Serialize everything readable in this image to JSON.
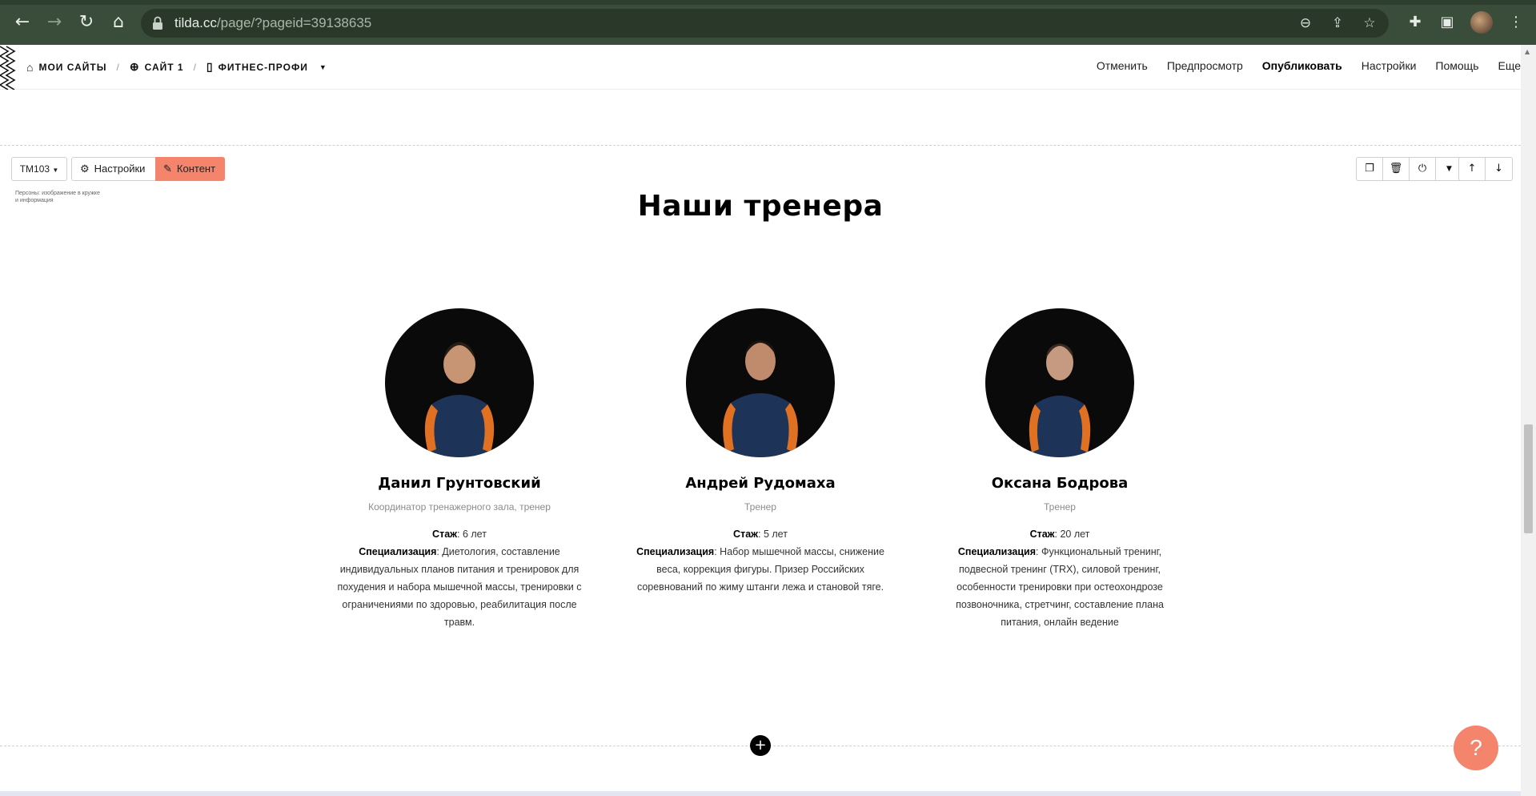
{
  "browser": {
    "url_host": "tilda.cc",
    "url_path": "/page/?pageid=39138635",
    "icons": [
      "back-arrow-icon",
      "forward-arrow-icon",
      "reload-icon",
      "home-icon",
      "lock-icon",
      "zoom-icon",
      "share-icon",
      "star-icon",
      "extensions-icon",
      "side-panel-icon",
      "kebab-menu-icon"
    ]
  },
  "tilda": {
    "breadcrumbs": [
      {
        "label": "МОИ САЙТЫ",
        "icon": "home-icon"
      },
      {
        "label": "САЙТ 1",
        "icon": "globe-icon"
      },
      {
        "label": "ФИТНЕС-ПРОФИ",
        "icon": "page-icon"
      }
    ],
    "menu": {
      "cancel": "Отменить",
      "preview": "Предпросмотр",
      "publish": "Опубликовать",
      "settings": "Настройки",
      "help": "Помощь",
      "more": "Еще"
    }
  },
  "block_toolbar": {
    "block_id": "TM103",
    "settings_label": "Настройки",
    "content_label": "Контент",
    "description": "Персоны: изображение в кружке и информация"
  },
  "section": {
    "title": "Наши тренера",
    "trainers": [
      {
        "name": "Данил Грунтовский",
        "role": "Координатор тренажерного зала, тренер",
        "experience_label": "Стаж",
        "experience_value": ": 6 лет",
        "spec_label": "Специализация",
        "spec_value": ": Диетология, составление индивидуальных планов питания и тренировок для похудения и набора мышечной массы, тренировки с ограничениями по здоровью, реабилитация после травм."
      },
      {
        "name": "Андрей Рудомаха",
        "role": "Тренер",
        "experience_label": "Стаж",
        "experience_value": ": 5 лет",
        "spec_label": "Специализация",
        "spec_value": ": Набор мышечной массы, снижение веса, коррекция фигуры. Призер Российских соревнований по жиму штанги лежа и становой тяге."
      },
      {
        "name": "Оксана Бодрова",
        "role": "Тренер",
        "experience_label": "Стаж",
        "experience_value": ": 20 лет",
        "spec_label": "Специализация",
        "spec_value": ": Функциональный тренинг, подвесной тренинг (TRX), силовой тренинг, особенности тренировки при остеохондрозе позвоночника, стретчинг, составление плана питания, онлайн ведение"
      }
    ]
  },
  "help_button": "?",
  "add_block": "+",
  "colors": {
    "chrome": "#3a4d3a",
    "accent": "#f4846b"
  }
}
